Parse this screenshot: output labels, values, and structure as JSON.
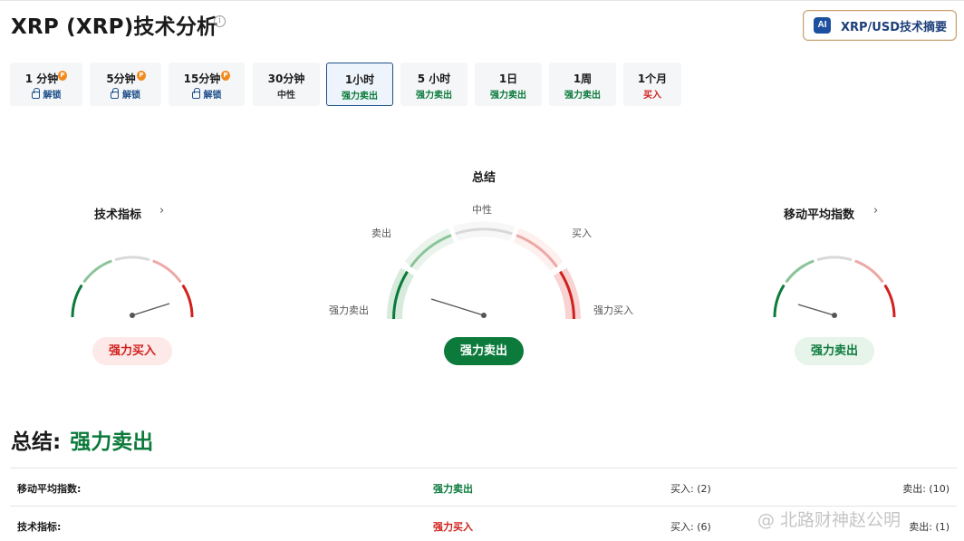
{
  "header": {
    "title": "XRP (XRP)技术分析",
    "info_icon": "i",
    "ai_badge": "AI",
    "ai_button_label": "XRP/USD技术摘要"
  },
  "tabs": [
    {
      "label": "1 分钟",
      "sub": "解锁",
      "pro": true,
      "locked": true
    },
    {
      "label": "5分钟",
      "sub": "解锁",
      "pro": true,
      "locked": true
    },
    {
      "label": "15分钟",
      "sub": "解锁",
      "pro": true,
      "locked": true
    },
    {
      "label": "30分钟",
      "sub": "中性",
      "pro": false,
      "locked": false
    },
    {
      "label": "1小时",
      "sub": "强力卖出",
      "pro": false,
      "locked": false,
      "active": true
    },
    {
      "label": "5 小时",
      "sub": "强力卖出",
      "pro": false,
      "locked": false
    },
    {
      "label": "1日",
      "sub": "强力卖出",
      "pro": false,
      "locked": false
    },
    {
      "label": "1周",
      "sub": "强力卖出",
      "pro": false,
      "locked": false
    },
    {
      "label": "1个月",
      "sub": "买入",
      "pro": false,
      "locked": false
    }
  ],
  "gauges": {
    "technical": {
      "title": "技术指标",
      "result": "强力买入"
    },
    "summary": {
      "title": "总结",
      "result": "强力卖出",
      "labels": {
        "neutral": "中性",
        "sell": "卖出",
        "buy": "买入",
        "strong_sell": "强力卖出",
        "strong_buy": "强力买入"
      }
    },
    "moving_avg": {
      "title": "移动平均指数",
      "result": "强力卖出"
    }
  },
  "summary": {
    "label": "总结:",
    "value": "强力卖出",
    "rows": [
      {
        "name": "移动平均指数:",
        "value": "强力卖出",
        "buy": "买入: (2)",
        "sell": "卖出: (10)"
      },
      {
        "name": "技术指标:",
        "value": "强力买入",
        "buy": "买入: (6)",
        "sell": "卖出: (1)"
      }
    ]
  },
  "colors": {
    "strong_sell": "#0b7a3b",
    "sell": "#8cc49a",
    "neutral": "#d9d9d9",
    "buy": "#eca8a4",
    "strong_buy": "#d0211e",
    "primary": "#1d4f8a"
  },
  "watermark": "@ 北路财神赵公明"
}
